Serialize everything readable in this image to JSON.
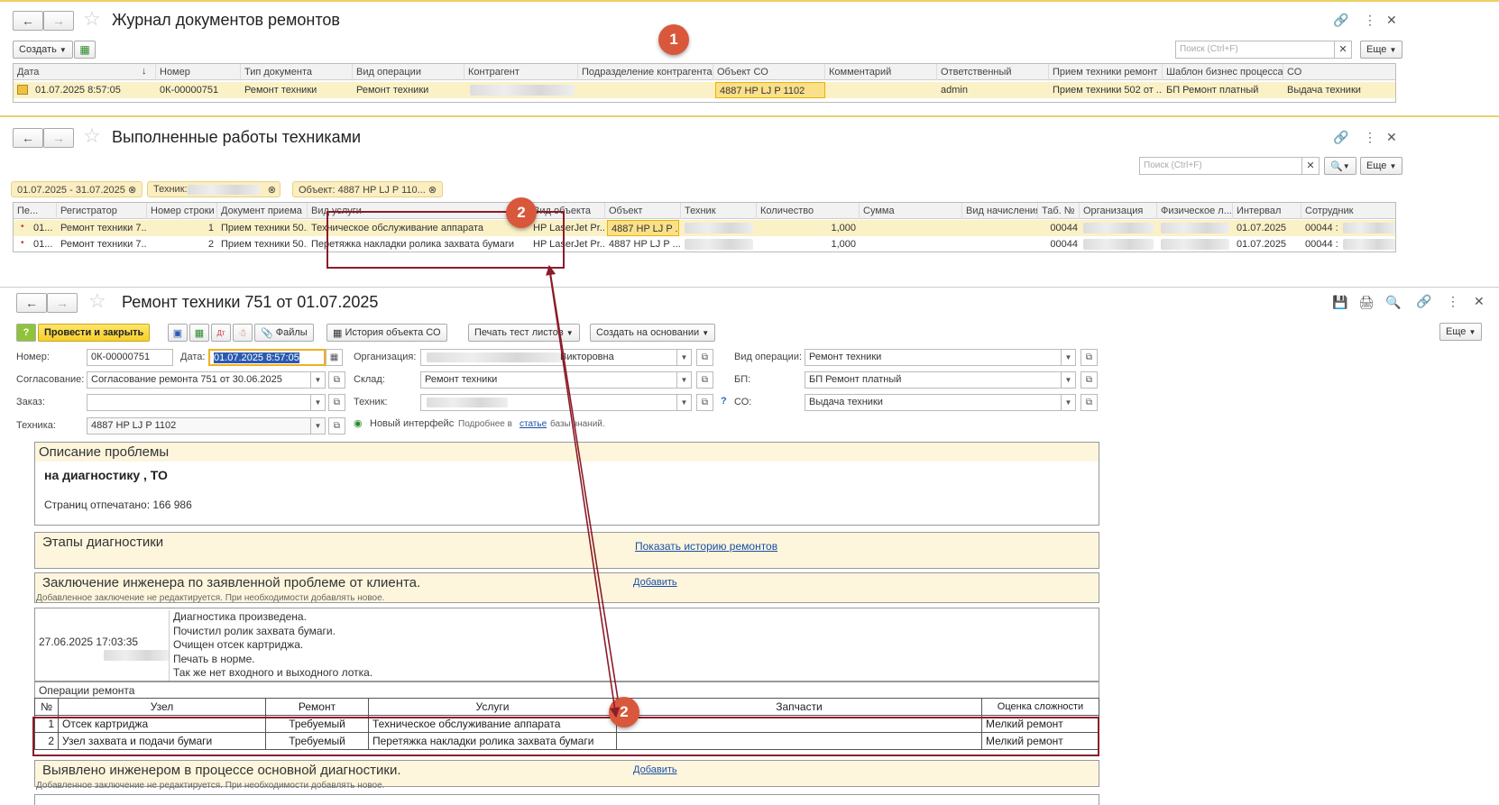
{
  "win1": {
    "title": "Журнал документов ремонтов",
    "create": "Создать",
    "search_ph": "Поиск (Ctrl+F)",
    "more": "Еще",
    "cols": [
      "Дата",
      "Номер",
      "Тип документа",
      "Вид операции",
      "Контрагент",
      "Подразделение контрагента",
      "Объект СО",
      "Комментарий",
      "Ответственный",
      "Прием техники ремонт",
      "Шаблон бизнес процесса",
      "СО"
    ],
    "row": [
      "01.07.2025 8:57:05",
      "0К-00000751",
      "Ремонт техники",
      "Ремонт техники",
      "",
      "",
      "4887 HP LJ P 1102",
      "",
      "admin",
      "Прием техники 502 от ...",
      "БП Ремонт платный",
      "Выдача техники"
    ]
  },
  "badge1": "1",
  "badge2": "2",
  "win2": {
    "title": "Выполненные работы техниками",
    "search_ph": "Поиск (Ctrl+F)",
    "more": "Еще",
    "chips": [
      "01.07.2025 - 31.07.2025",
      "Техник:",
      "Объект: 4887 HP LJ P 110..."
    ],
    "cols": [
      "Пе...",
      "Регистратор",
      "Номер строки",
      "Документ приема",
      "Вид услуги",
      "Вид объекта",
      "Объект",
      "Техник",
      "Количество",
      "Сумма",
      "Вид начисления",
      "Таб. №",
      "Организация",
      "Физическое л...",
      "Интервал",
      "Сотрудник"
    ],
    "rows": [
      [
        "01...",
        "Ремонт техники 7...",
        "1",
        "Прием техники 50...",
        "Техническое обслуживание аппарата",
        "HP LaserJet Pr...",
        "4887 HP LJ P ...",
        "",
        "1,000",
        "",
        "",
        "00044",
        "",
        "",
        "01.07.2025",
        "00044 : "
      ],
      [
        "01...",
        "Ремонт техники 7...",
        "2",
        "Прием техники 50...",
        "Перетяжка накладки ролика захвата бумаги",
        "HP LaserJet Pr...",
        "4887 HP LJ P ...",
        "",
        "1,000",
        "",
        "",
        "00044",
        "",
        "",
        "01.07.2025",
        "00044 : "
      ]
    ]
  },
  "win3": {
    "title": "Ремонт техники 751 от 01.07.2025",
    "toolbar": {
      "post_close": "Провести и закрыть",
      "files": "Файлы",
      "history": "История объекта СО",
      "print": "Печать тест листов",
      "create_basis": "Создать на основании",
      "more": "Еще"
    },
    "form": {
      "number_lbl": "Номер:",
      "number": "0К-00000751",
      "date_lbl": "Дата:",
      "date": "01.07.2025  8:57:05",
      "org_lbl": "Организация:",
      "org": "Викторовна",
      "op_lbl": "Вид операции:",
      "op": "Ремонт техники",
      "agree_lbl": "Согласование:",
      "agree": "Согласование ремонта 751 от 30.06.2025",
      "sklad_lbl": "Склад:",
      "sklad": "Ремонт техники",
      "bp_lbl": "БП:",
      "bp": "БП Ремонт платный",
      "order_lbl": "Заказ:",
      "order": "",
      "tech_lbl": "Техник:",
      "so_lbl": "СО:",
      "so": "Выдача техники",
      "equip_lbl": "Техника:",
      "equip": "4887 HP LJ P 1102",
      "new_ui": "Новый интерфейс",
      "more_info": "Подробнее в",
      "article": "статье",
      "kb": "базы знаний."
    },
    "problem": {
      "title": "Описание проблемы",
      "text": "на диагностику , ТО",
      "pages": "Страниц отпечатано: 166 986"
    },
    "diag": {
      "title": "Этапы диагностики",
      "link": "Показать историю ремонтов"
    },
    "concl": {
      "title": "Заключение инженера по заявленной проблеме от клиента.",
      "add": "Добавить",
      "note": "Добавленное заключение не редактируется. При необходимости добавлять новое.",
      "date": "27.06.2025 17:03:35",
      "lines": [
        "Диагностика произведена.",
        "Почистил ролик захвата бумаги.",
        "Очищен отсек картриджа.",
        "Печать в норме.",
        "Так же нет входного и выходного лотка."
      ]
    },
    "ops": {
      "title": "Операции ремонта",
      "head": [
        "№",
        "Узел",
        "Ремонт",
        "Услуги",
        "Запчасти",
        "Оценка сложности"
      ],
      "rows": [
        [
          "1",
          "Отсек картриджа",
          "Требуемый",
          "Техническое обслуживание аппарата",
          "",
          "Мелкий ремонт"
        ],
        [
          "2",
          "Узел захвата и подачи бумаги",
          "Требуемый",
          "Перетяжка накладки ролика захвата бумаги",
          "",
          "Мелкий ремонт"
        ]
      ]
    },
    "found": {
      "title": "Выявлено инженером в процессе основной диагностики.",
      "add": "Добавить",
      "note": "Добавленное заключение не редактируется. При необходимости добавлять новое."
    }
  },
  "colors": {
    "accent_yellow": "#fbeec0",
    "annotation_red": "#8b1c2a",
    "badge": "#d9583b",
    "selected_row": "#fbf1c7"
  }
}
